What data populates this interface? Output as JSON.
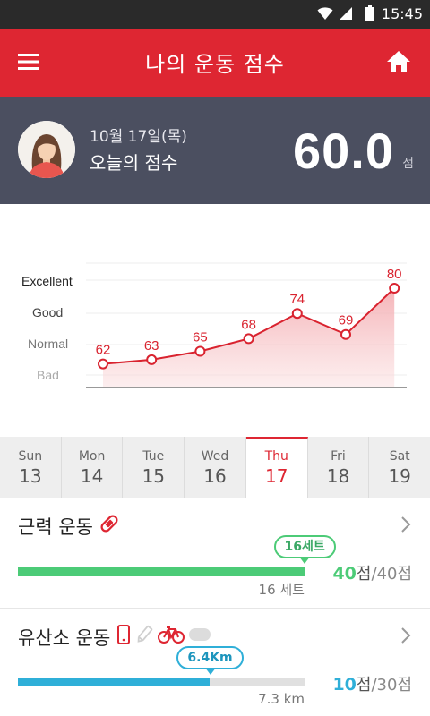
{
  "status_bar": {
    "time": "15:45"
  },
  "app_bar": {
    "title": "나의 운동 점수"
  },
  "header": {
    "date": "10월 17일(목)",
    "label": "오늘의 점수",
    "score": "60.0",
    "unit": "점"
  },
  "chart_data": {
    "type": "line",
    "categories": [
      "Sun",
      "Mon",
      "Tue",
      "Wed",
      "Thu",
      "Fri",
      "Sat"
    ],
    "values": [
      62,
      63,
      65,
      68,
      74,
      69,
      80
    ],
    "y_labels": [
      "Excellent",
      "Good",
      "Normal",
      "Bad"
    ],
    "grid": true,
    "colors": {
      "line": "#d9232f",
      "fill": "#f7c6c9"
    }
  },
  "days": [
    {
      "name": "Sun",
      "num": "13"
    },
    {
      "name": "Mon",
      "num": "14"
    },
    {
      "name": "Tue",
      "num": "15"
    },
    {
      "name": "Wed",
      "num": "16"
    },
    {
      "name": "Thu",
      "num": "17"
    },
    {
      "name": "Fri",
      "num": "18"
    },
    {
      "name": "Sat",
      "num": "19"
    }
  ],
  "strength": {
    "title": "근력 운동",
    "tooltip": "16세트",
    "progress": 1.0,
    "sub": "16 세트",
    "points": "40",
    "point_unit": "점",
    "total": "/40점",
    "color": "#4ccb77"
  },
  "cardio": {
    "title": "유산소 운동",
    "tooltip": "6.4Km",
    "progress": 0.67,
    "sub": "7.3 km",
    "points": "10",
    "point_unit": "점",
    "total": "/30점",
    "color": "#2fafd8"
  },
  "icons": {
    "menu": "hamburger-icon",
    "home": "home-icon",
    "strength": "band-icon",
    "phone": "phone-icon",
    "bike": "bicycle-icon"
  }
}
